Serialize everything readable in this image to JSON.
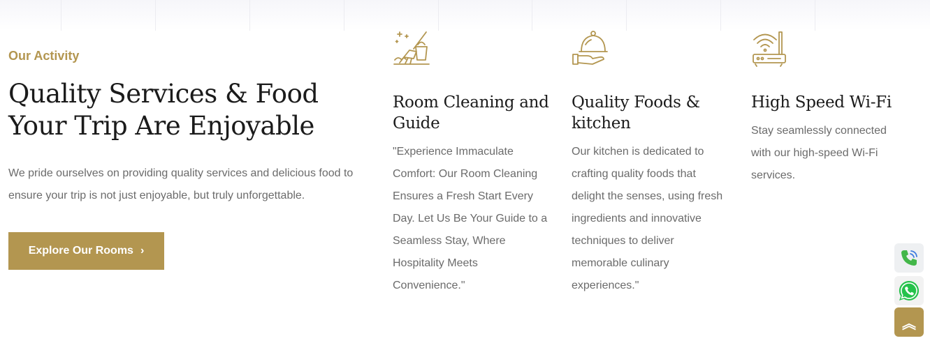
{
  "section": {
    "eyebrow": "Our Activity",
    "title": "Quality Services & Food Your Trip Are Enjoyable",
    "description": "We pride ourselves on providing quality services and delicious food to ensure your trip is not just enjoyable, but truly unforgettable.",
    "cta_label": "Explore Our Rooms",
    "cta_icon": "chevron-right-icon"
  },
  "features": [
    {
      "icon": "cleaning-icon",
      "title": "Room Cleaning and Guide",
      "text": "\"Experience Immaculate Comfort: Our Room Cleaning Ensures a Fresh Start Every Day. Let Us Be Your Guide to a Seamless Stay, Where Hospitality Meets Convenience.\""
    },
    {
      "icon": "food-cloche-icon",
      "title": "Quality Foods & kitchen",
      "text": "Our kitchen is dedicated to crafting quality foods that delight the senses, using fresh ingredients and innovative techniques to deliver memorable culinary experiences.\""
    },
    {
      "icon": "wifi-router-icon",
      "title": "High Speed Wi-Fi",
      "text": "Stay seamlessly connected with our high-speed Wi-Fi services."
    }
  ],
  "floating": {
    "phone_icon": "phone-icon",
    "whatsapp_icon": "whatsapp-icon",
    "top_icon": "double-chevron-up-icon",
    "top_glyph": "︽"
  },
  "colors": {
    "accent": "#b39650",
    "heading": "#1b1b1b",
    "body": "#6b6b6b"
  }
}
